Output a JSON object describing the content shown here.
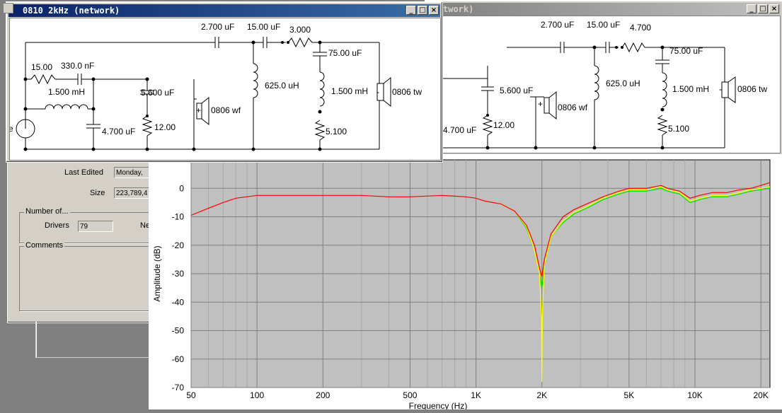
{
  "window_left": {
    "title": "0810 2kHz (network)",
    "buttons": [
      "_",
      "□",
      "×"
    ],
    "components": {
      "r1": "15.00",
      "c1": "330.0 nF",
      "l1": "1.500 mH",
      "c2": "4.700 uF",
      "c3": "5.600 uF",
      "r2": "12.00",
      "drv_wf": "0806 wf",
      "c4": "2.700 uF",
      "c5": "15.00 uF",
      "r3": "3.000",
      "l2": "625.0 uH",
      "c6": "75.00 uF",
      "l3": "1.500 mH",
      "r4": "5.100",
      "drv_tw": "0806 tw",
      "plus": "+",
      "minus": "-",
      "source_label": "e"
    }
  },
  "window_right": {
    "title": "twork)",
    "buttons": [
      "_",
      "□",
      "×"
    ],
    "components": {
      "c3": "5.600 uF",
      "c2": "4.700 uF",
      "r2": "12.00",
      "drv_wf": "0806 wf",
      "c4": "2.700 uF",
      "c5": "15.00 uF",
      "r3": "4.700",
      "l2": "625.0 uH",
      "c6": "75.00 uF",
      "l3": "1.500 mH",
      "r4": "5.100",
      "drv_tw": "0806 tw",
      "plus": "+",
      "minus": "-"
    }
  },
  "properties": {
    "last_edited_label": "Last Edited",
    "last_edited_value": "Monday,",
    "size_label": "Size",
    "size_value": "223,789,4",
    "number_of_title": "Number of...",
    "drivers_label": "Drivers",
    "drivers_value": "79",
    "ne_label": "Ne",
    "comments_title": "Comments"
  },
  "chart_data": {
    "type": "line",
    "xlabel": "Frequency (Hz)",
    "ylabel": "Amplitude (dB)",
    "x_scale": "log",
    "xlim": [
      50,
      22000
    ],
    "ylim": [
      -70,
      10
    ],
    "x_ticks": [
      {
        "v": 50,
        "label": "50"
      },
      {
        "v": 100,
        "label": "100"
      },
      {
        "v": 200,
        "label": "200"
      },
      {
        "v": 500,
        "label": "500"
      },
      {
        "v": 1000,
        "label": "1K"
      },
      {
        "v": 2000,
        "label": "2K"
      },
      {
        "v": 5000,
        "label": "5K"
      },
      {
        "v": 10000,
        "label": "10K"
      },
      {
        "v": 20000,
        "label": "20K"
      }
    ],
    "y_ticks": [
      0,
      -10,
      -20,
      -30,
      -40,
      -50,
      -60,
      -70
    ],
    "background": "#c0c0c0",
    "grid": true,
    "series": [
      {
        "color": "#00e000",
        "points": [
          [
            1300,
            -5.5
          ],
          [
            1500,
            -8
          ],
          [
            1700,
            -14
          ],
          [
            1850,
            -22
          ],
          [
            1950,
            -30
          ],
          [
            2000,
            -35
          ],
          [
            2050,
            -27
          ],
          [
            2200,
            -17
          ],
          [
            2500,
            -12
          ],
          [
            2800,
            -9
          ],
          [
            3200,
            -7
          ],
          [
            3800,
            -4
          ],
          [
            4500,
            -2
          ],
          [
            5000,
            -1
          ],
          [
            6000,
            -1
          ],
          [
            7000,
            0
          ],
          [
            7500,
            -1
          ],
          [
            8500,
            -2
          ],
          [
            9500,
            -5
          ],
          [
            10500,
            -4
          ],
          [
            12000,
            -3
          ],
          [
            14000,
            -3
          ],
          [
            16000,
            -2
          ],
          [
            18000,
            -1
          ],
          [
            20000,
            -0.5
          ],
          [
            22000,
            0
          ]
        ]
      },
      {
        "color": "#ffff00",
        "points": [
          [
            1300,
            -5.5
          ],
          [
            1500,
            -8
          ],
          [
            1700,
            -13.5
          ],
          [
            1850,
            -22
          ],
          [
            1950,
            -30
          ],
          [
            1990,
            -45
          ],
          [
            2000,
            -68
          ],
          [
            2010,
            -45
          ],
          [
            2050,
            -27
          ],
          [
            2200,
            -17
          ],
          [
            2500,
            -11.5
          ],
          [
            2800,
            -8.5
          ],
          [
            3200,
            -6.5
          ],
          [
            3800,
            -3.5
          ],
          [
            4500,
            -1.5
          ],
          [
            5000,
            -0.5
          ],
          [
            6000,
            -0.5
          ],
          [
            7000,
            0.5
          ],
          [
            7500,
            -0.5
          ],
          [
            8500,
            -1.5
          ],
          [
            9500,
            -4.5
          ],
          [
            10500,
            -3.5
          ],
          [
            12000,
            -2.5
          ],
          [
            14000,
            -2.5
          ],
          [
            16000,
            -1.5
          ],
          [
            18000,
            -0.5
          ],
          [
            20000,
            0
          ],
          [
            22000,
            0.5
          ]
        ]
      },
      {
        "color": "#ff0000",
        "points": [
          [
            50,
            -9.5
          ],
          [
            60,
            -7
          ],
          [
            70,
            -5
          ],
          [
            80,
            -3.5
          ],
          [
            100,
            -2.5
          ],
          [
            150,
            -2.5
          ],
          [
            200,
            -2.5
          ],
          [
            300,
            -2.5
          ],
          [
            400,
            -3
          ],
          [
            500,
            -3
          ],
          [
            700,
            -2.5
          ],
          [
            900,
            -3
          ],
          [
            1000,
            -3.5
          ],
          [
            1100,
            -4.5
          ],
          [
            1300,
            -5.5
          ],
          [
            1500,
            -8
          ],
          [
            1700,
            -13
          ],
          [
            1850,
            -20
          ],
          [
            1950,
            -28
          ],
          [
            2000,
            -31
          ],
          [
            2050,
            -25
          ],
          [
            2200,
            -16
          ],
          [
            2500,
            -10
          ],
          [
            2800,
            -7.5
          ],
          [
            3200,
            -5.5
          ],
          [
            3800,
            -3
          ],
          [
            4500,
            -1
          ],
          [
            5000,
            0
          ],
          [
            6000,
            0
          ],
          [
            7000,
            1
          ],
          [
            7500,
            0
          ],
          [
            8500,
            -1
          ],
          [
            9500,
            -3.5
          ],
          [
            10500,
            -2.5
          ],
          [
            12000,
            -1.5
          ],
          [
            14000,
            -1.5
          ],
          [
            16000,
            -0.5
          ],
          [
            18000,
            0
          ],
          [
            20000,
            1
          ],
          [
            22000,
            2
          ]
        ]
      }
    ]
  }
}
